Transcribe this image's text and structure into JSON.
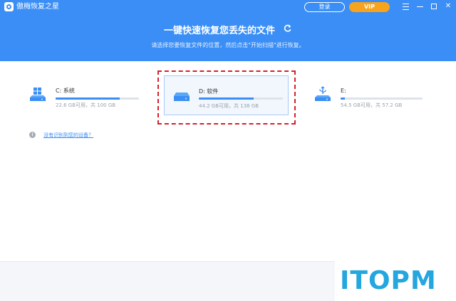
{
  "window": {
    "title": "傲梅恢复之星",
    "login_label": "登录",
    "vip_label": "VIP"
  },
  "header": {
    "headline": "一键快速恢复您丢失的文件",
    "subline": "请选择您要恢复文件的位置，然后点击\"开始扫描\"进行恢复。"
  },
  "drives": [
    {
      "name": "C: 系统",
      "space": "22.6 GB可用，共 100 GB",
      "usage_fraction": 0.77,
      "icon": "windows-drive-icon"
    },
    {
      "name": "D: 软件",
      "space": "44.2 GB可用，共 138 GB",
      "usage_fraction": 0.65,
      "icon": "hard-drive-icon",
      "selected": true
    },
    {
      "name": "E:",
      "space": "54.5 GB可用，共 57.2 GB",
      "usage_fraction": 0.05,
      "icon": "usb-drive-icon"
    }
  ],
  "help_link": "没有识别到您的设备？",
  "watermark": "ITOPM",
  "colors": {
    "accent": "#3a8ef5",
    "vip": "#f7a41c",
    "highlight": "#d7202a",
    "watermark": "#24a6df"
  }
}
